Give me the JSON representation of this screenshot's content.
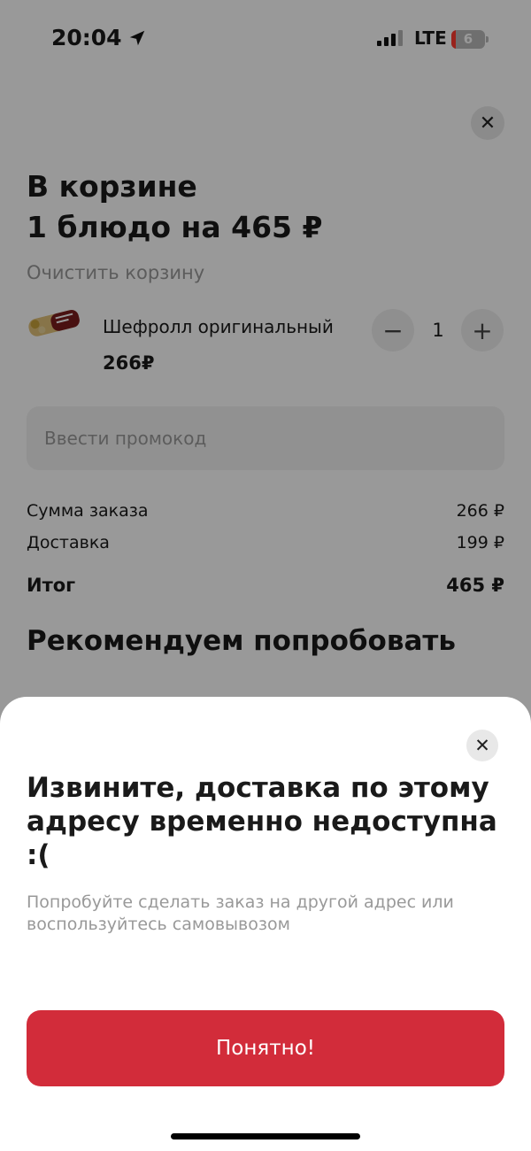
{
  "status_bar": {
    "time": "20:04",
    "network": "LTE",
    "battery_level": "6",
    "battery_fraction": 0.06,
    "icons": [
      "location-arrow-icon",
      "signal-icon",
      "battery-icon"
    ]
  },
  "cart": {
    "title_line1": "В корзине",
    "title_line2": "1 блюдо на 465 ₽",
    "clear_label": "Очистить корзину",
    "item": {
      "name": "Шефролл оригинальный",
      "price": "266₽",
      "quantity": "1",
      "minus_label": "−",
      "plus_label": "+"
    },
    "promo_placeholder": "Ввести промокод",
    "summary": [
      {
        "label": "Сумма заказа",
        "value": "266 ₽"
      },
      {
        "label": "Доставка",
        "value": "199 ₽"
      },
      {
        "label": "Итог",
        "value": "465 ₽"
      }
    ],
    "recommend_title": "Рекомендуем попробовать"
  },
  "modal": {
    "title": "Извините, доставка по этому адресу временно недоступна :(",
    "subtitle": "Попробуйте сделать заказ на другой адрес или воспользуйтесь самовывозом",
    "button_label": "Понятно!"
  },
  "colors": {
    "accent": "#d22c3a",
    "battery_low": "#ff3b30",
    "muted_text": "#999999"
  }
}
